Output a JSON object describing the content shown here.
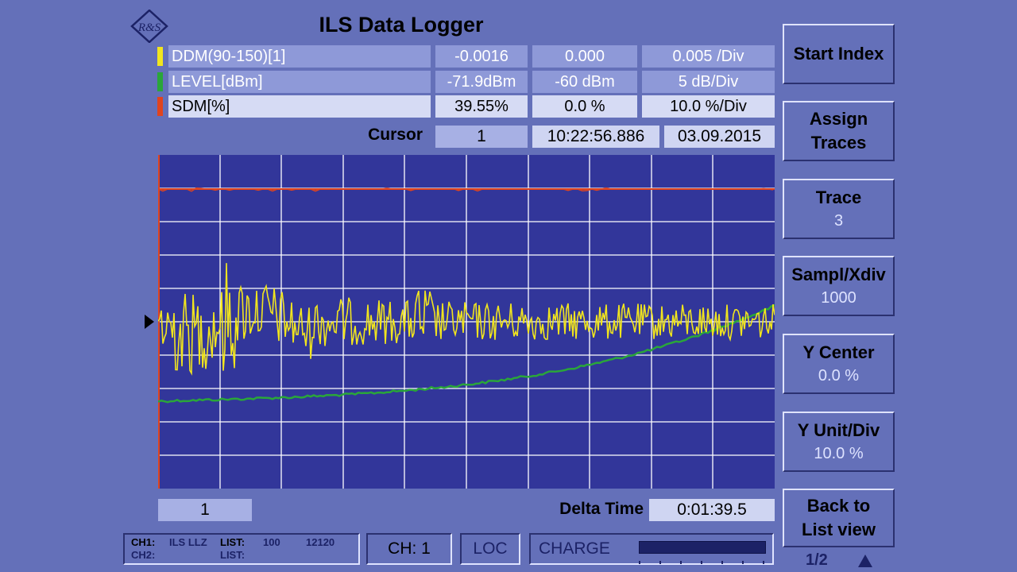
{
  "header": {
    "title": "ILS Data Logger",
    "logo_text": "R&S"
  },
  "traces": [
    {
      "color": "#f1e51e",
      "name": "DDM(90-150)[1]",
      "value": "-0.0016",
      "center": "0.000",
      "scale": "0.005 /Div"
    },
    {
      "color": "#2aa63a",
      "name": "LEVEL[dBm]",
      "value": "-71.9dBm",
      "center": "-60 dBm",
      "scale": "5 dB/Div"
    },
    {
      "color": "#e0441e",
      "name": "SDM[%]",
      "value": "39.55%",
      "center": "0.0 %",
      "scale": "10.0 %/Div"
    }
  ],
  "cursor": {
    "label": "Cursor",
    "index": "1",
    "time": "10:22:56.886",
    "date": "03.09.2015"
  },
  "plot": {
    "background": "#32369a",
    "grid_color": "#ffffff",
    "grid_cols": 10,
    "grid_rows": 10
  },
  "footer": {
    "position": "1",
    "delta_label": "Delta Time",
    "delta_value": "0:01:39.5"
  },
  "softkeys": [
    {
      "label": "Start Index",
      "value": ""
    },
    {
      "label": "Assign Traces",
      "value": ""
    },
    {
      "label": "Trace",
      "value": "3"
    },
    {
      "label": "Sampl/Xdiv",
      "value": "1000"
    },
    {
      "label": "Y Center",
      "value": "0.0 %"
    },
    {
      "label": "Y Unit/Div",
      "value": "10.0 %"
    },
    {
      "label": "Back to List view",
      "value": ""
    }
  ],
  "page_indicator": "1/2",
  "status": {
    "ch1_label": "CH1:",
    "ch1_value": "ILS LLZ",
    "ch1_list_label": "LIST:",
    "ch1_list_value": "100",
    "ch1_extra": "12120",
    "ch2_label": "CH2:",
    "ch2_list_label": "LIST:",
    "channel": "CH: 1",
    "loc": "LOC",
    "charge": "CHARGE"
  }
}
